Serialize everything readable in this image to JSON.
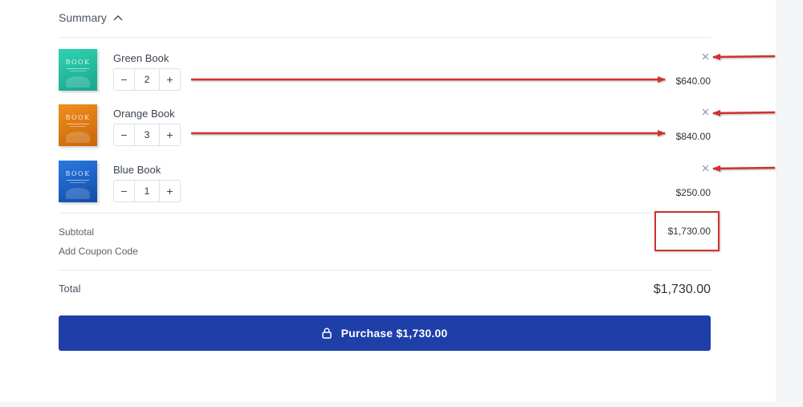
{
  "summary": {
    "label": "Summary",
    "icon": "chevron-up-icon"
  },
  "items": [
    {
      "name": "Green Book",
      "quantity": "2",
      "price": "$640.00",
      "cover_color": "#24c0a4",
      "cover_text": "BOOK"
    },
    {
      "name": "Orange Book",
      "quantity": "3",
      "price": "$840.00",
      "cover_color": "#e27d14",
      "cover_text": "BOOK"
    },
    {
      "name": "Blue Book",
      "quantity": "1",
      "price": "$250.00",
      "cover_color": "#1a5ec8",
      "cover_text": "BOOK"
    }
  ],
  "quantity_controls": {
    "decrement": "−",
    "increment": "+"
  },
  "remove_icon": "close-icon",
  "totals": {
    "subtotal_label": "Subtotal",
    "subtotal_value": "$1,730.00",
    "coupon_label": "Add Coupon Code",
    "total_label": "Total",
    "total_value": "$1,730.00"
  },
  "purchase": {
    "label": "Purchase $1,730.00",
    "icon": "lock-icon"
  },
  "colors": {
    "accent": "#1e3ea8",
    "annotation_red": "#d0312d"
  }
}
